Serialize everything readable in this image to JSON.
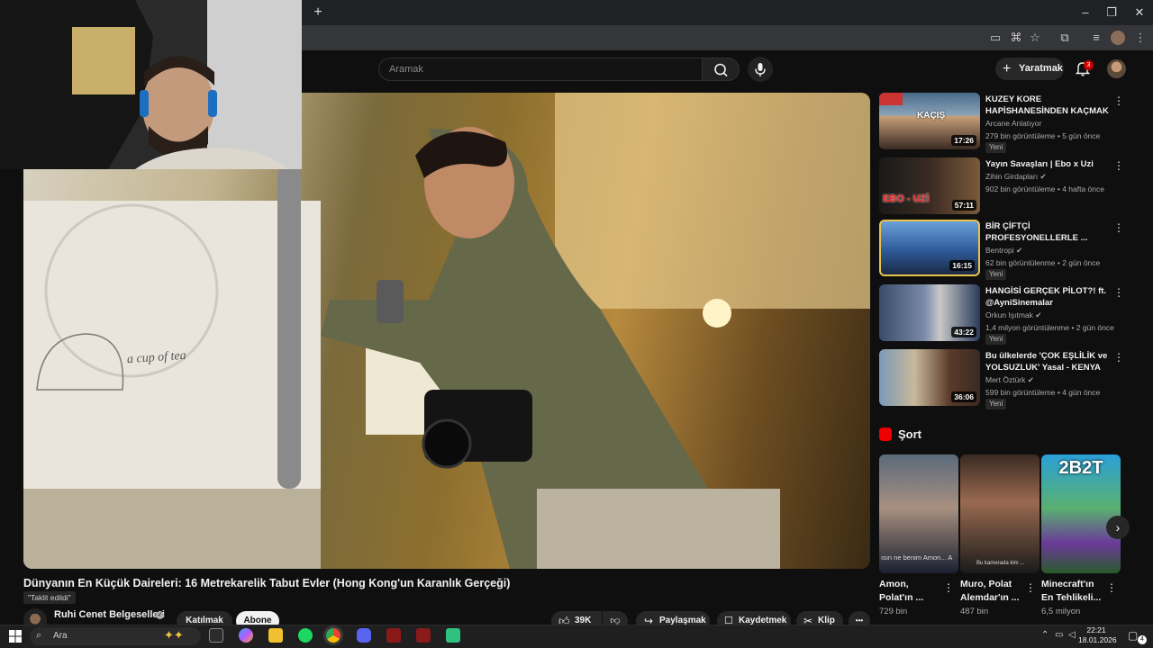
{
  "browser": {
    "new_tab_label": "+",
    "window_controls": [
      "–",
      "❐",
      "✕"
    ]
  },
  "header": {
    "search_placeholder": "Aramak",
    "create_label": "Yaratmak",
    "notification_count": "3"
  },
  "video": {
    "title": "Dünyanın En Küçük Daireleri: 16 Metrekarelik Tabut Evler (Hong Kong'un Karanlık Gerçeği)",
    "dub_label": "\"Taklit edildi\"",
    "overlay_text": "a cup of tea",
    "channel_name": "Ruhi Cenet Belgeselleri",
    "join_label": "Katılmak",
    "subscribe_label": "Abone",
    "like_count": "39K",
    "share_label": "Paylaşmak",
    "save_label": "Kaydetmek",
    "clip_label": "Klip",
    "more_label": "•••"
  },
  "recommendations": [
    {
      "title": "KUZEY KORE HAPİSHANESİNDEN KAÇMAK",
      "channel": "Arcane Anlatıyor",
      "verified": false,
      "meta": "279 bin görüntüleme • 5 gün önce",
      "badge": "Yeni",
      "duration": "17:26",
      "thumb_text": "KAÇIŞ"
    },
    {
      "title": "Yayın Savaşları | Ebo x Uzi",
      "channel": "Zihin Girdapları",
      "verified": true,
      "meta": "902 bin görüntüleme • 4 hafta önce",
      "badge": "",
      "duration": "57:11",
      "thumb_text": "EBO - UZİ"
    },
    {
      "title": "BİR ÇİFTÇİ PROFESYONELLERLE ...",
      "channel": "Bentropi",
      "verified": true,
      "meta": "62 bin görüntülenme • 2 gün önce",
      "badge": "Yeni",
      "duration": "16:15",
      "thumb_text": ""
    },
    {
      "title": "HANGİSİ GERÇEK PİLOT?! ft. @AyniSinemalar",
      "channel": "Orkun Işıtmak",
      "verified": true,
      "meta": "1,4 milyon görüntülenme • 2 gün önce",
      "badge": "Yeni",
      "duration": "43:22",
      "thumb_text": ""
    },
    {
      "title": "Bu ülkelerde 'ÇOK EŞLİLİK ve YOLSUZLUK' Yasal - KENYA",
      "channel": "Mert Öztürk",
      "verified": true,
      "meta": "599 bin görüntüleme • 4 gün önce",
      "badge": "Yeni",
      "duration": "36:06",
      "thumb_text": ""
    }
  ],
  "shorts": {
    "section_title": "Şort",
    "items": [
      {
        "title": "Amon, Polat'ın ...",
        "views": "729 bin",
        "caption": "ısın ne benim Amon... A"
      },
      {
        "title": "Muro, Polat Alemdar'ın ...",
        "views": "487 bin",
        "caption": "Bu kamerada kim ..."
      },
      {
        "title": "Minecraft'ın En Tehlikeli...",
        "views": "6,5 milyon",
        "caption": "2B2T"
      }
    ]
  },
  "taskbar": {
    "search_label": "Ara",
    "time": "22:21",
    "date": "18.01.2026",
    "notification_count": "4"
  },
  "colors": {
    "background": "#0f0f0f",
    "youtube_red": "#ff0000",
    "badge_red": "#cc0000",
    "chrome_dark": "#202124"
  }
}
